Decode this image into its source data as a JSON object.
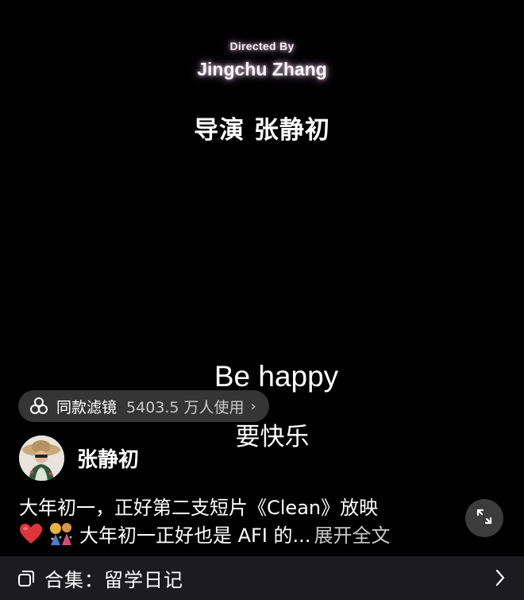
{
  "video": {
    "credit_small": "Directed By",
    "credit_name": "Jingchu Zhang",
    "subtitle_director": "导演 张静初",
    "subtitle_en": "Be happy",
    "subtitle_zh": "要快乐"
  },
  "filter": {
    "name": "同款滤镜",
    "usage": "5403.5 万人使用",
    "icon": "filter-icon"
  },
  "author": {
    "name": "张静初"
  },
  "caption": {
    "line1": "大年初一，正好第二支短片《Clean》放映",
    "line2_text": "大年初一正好也是 AFI 的...",
    "more_label": "展开全文",
    "emojis": [
      "red-heart-emoji",
      "celebration-emoji"
    ]
  },
  "collection": {
    "label": "合集：留学日记",
    "icon": "collection-icon"
  },
  "colors": {
    "background": "#000000",
    "bar_background": "#1c1c1e",
    "pill_background": "#3c3c3c",
    "muted_text": "#c9c9c9"
  }
}
